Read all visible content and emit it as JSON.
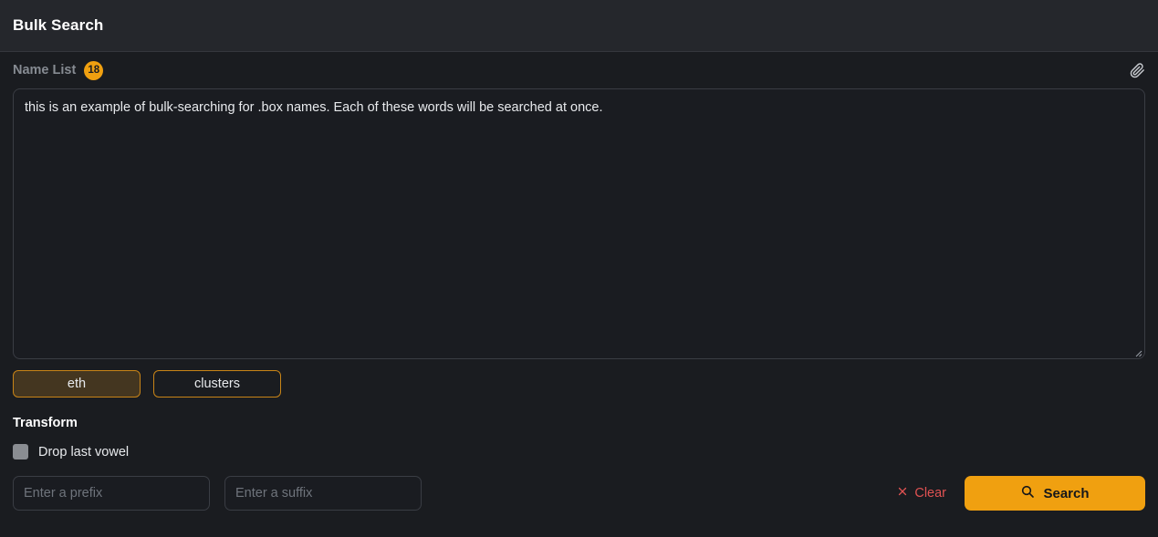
{
  "header": {
    "title": "Bulk Search"
  },
  "name_list": {
    "label": "Name List",
    "count": "18",
    "attach_icon": "paperclip-icon",
    "textarea_value": "this is an example of bulk-searching for .box names. Each of these words will be searched at once.",
    "textarea_placeholder": ""
  },
  "chips": [
    {
      "label": "eth",
      "selected": true
    },
    {
      "label": "clusters",
      "selected": false
    }
  ],
  "transform": {
    "title": "Transform",
    "drop_last_vowel_label": "Drop last vowel",
    "drop_last_vowel_checked": false
  },
  "bottom": {
    "prefix_value": "",
    "prefix_placeholder": "Enter a prefix",
    "suffix_value": "",
    "suffix_placeholder": "Enter a suffix",
    "clear_label": "Clear",
    "clear_icon": "close-x-icon",
    "search_label": "Search",
    "search_icon": "search-icon"
  },
  "colors": {
    "accent_orange": "#f0a010",
    "chip_border": "#c88417",
    "chip_selected_bg": "#443620",
    "clear_red": "#e05252",
    "header_bg": "#25272c",
    "page_bg": "#1a1c20",
    "field_bg": "#1a1c21",
    "field_border": "#3a3d44",
    "muted_text": "#868b92"
  }
}
